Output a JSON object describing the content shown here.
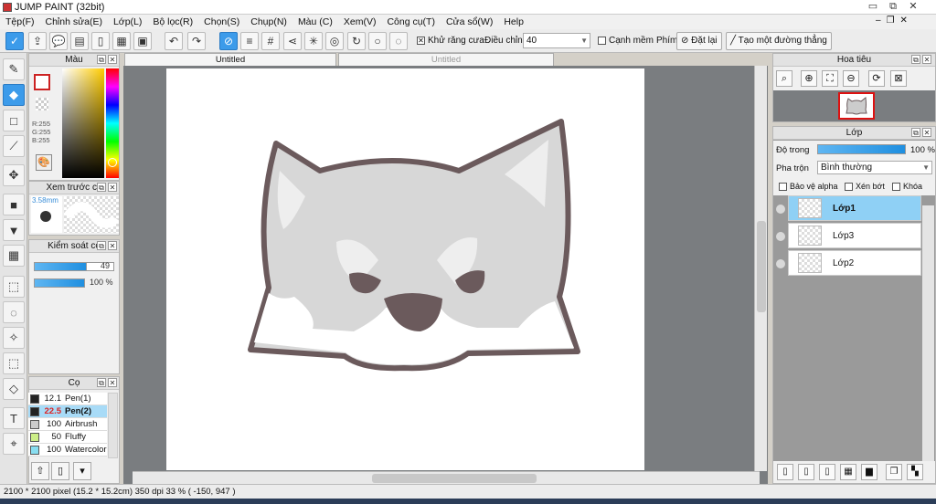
{
  "window": {
    "title": "JUMP PAINT (32bit)"
  },
  "menu": [
    "Tệp(F)",
    "Chỉnh sửa(E)",
    "Lớp(L)",
    "Bộ lọc(R)",
    "Chọn(S)",
    "Chụp(N)",
    "Màu (C)",
    "Xem(V)",
    "Công cụ(T)",
    "Cửa sổ(W)",
    "Help"
  ],
  "toolbar": {
    "antialias_label": "Khử răng cưa",
    "adjust_label": "Điều chỉnh",
    "adjust_value": "40",
    "soft_edge_label": "Cạnh mềm",
    "key_label": "Phím",
    "reset_label": "Đặt lại",
    "straight_line_label": "Tạo một đường thẳng"
  },
  "tabs": {
    "active": "Untitled",
    "inactive": "Untitled"
  },
  "color_panel": {
    "title": "Màu",
    "r": "R:255",
    "g": "G:255",
    "b": "B:255",
    "primary_color": "#ffffff",
    "outline_color": "#cc2222"
  },
  "brush_preview": {
    "title": "Xem trước cọ",
    "size": "3.58mm"
  },
  "brush_control": {
    "title": "Kiểm soát cọ",
    "size_value": "49",
    "opacity_value": "100 %"
  },
  "brush_panel": {
    "title": "Cọ",
    "items": [
      {
        "size": "12.1",
        "name": "Pen(1)",
        "color": "#222222"
      },
      {
        "size": "22.5",
        "name": "Pen(2)",
        "color": "#222222"
      },
      {
        "size": "100",
        "name": "Airbrush",
        "color": "#cccccc"
      },
      {
        "size": "50",
        "name": "Fluffy Wate",
        "color": "#ccee88"
      },
      {
        "size": "100",
        "name": "Watercolor",
        "color": "#88ddf0"
      }
    ]
  },
  "navigator": {
    "title": "Hoa tiêu"
  },
  "layer_panel": {
    "title": "Lớp",
    "opacity_label": "Độ trong",
    "opacity_value": "100 %",
    "blend_label": "Pha trộn",
    "blend_value": "Bình thường",
    "protect_alpha": "Bảo vệ alpha",
    "clip": "Xén bớt",
    "lock": "Khóa",
    "layers": [
      {
        "name": "Lớp1"
      },
      {
        "name": "Lớp3"
      },
      {
        "name": "Lớp2"
      }
    ]
  },
  "status": {
    "text": "2100 * 2100 pixel   (15.2 * 15.2cm)   350 dpi   33 %   ( -150, 947 )"
  }
}
